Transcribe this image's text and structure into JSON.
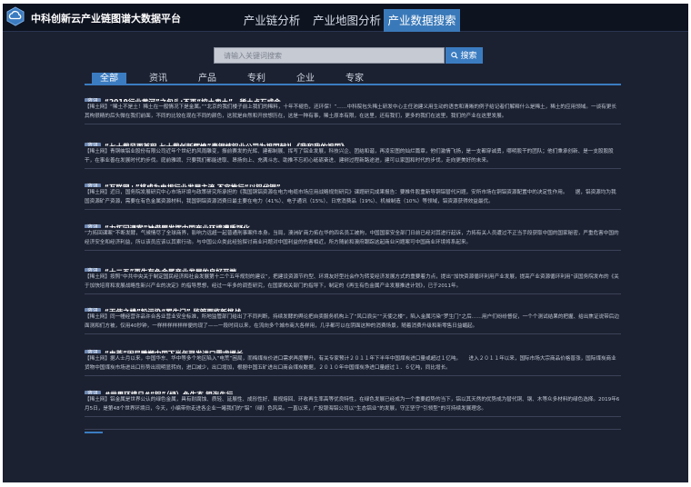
{
  "header": {
    "app_title": "中科创新云产业链图谱大数据平台",
    "nav": [
      "产业链分析",
      "产业地图分析",
      "产业数据搜索"
    ],
    "active_nav": "产业数据搜索"
  },
  "search": {
    "placeholder": "请输入关键词搜索",
    "button_label": "搜索"
  },
  "categories": {
    "items": [
      "全部",
      "资讯",
      "产品",
      "专利",
      "企业",
      "专家"
    ],
    "active": "全部"
  },
  "results": [
    {
      "tag": "资讯",
      "title": "“2019行业黄河”之包头:不再“挖土卖土”，稀土点石成金",
      "text": "【稀土网】“稀土不是土！稀土在一般情况下是金属。”“北京的我们楼子前上我们的稀料，十年不褪色，还环保！”……中科院包头稀土研发中心主任池建义用生动的语言和清晰的例子给记者们解释什么是稀土，稀土的应用领域。一谈有更长其构很精的后头微在我们前面，不同的比较在现在不同的颜色，这就是自然和开放想历在，这是一种有事，稀土原本有限，在这里，还有我们，更多的我们在这里，我们的产业在这里发展。"
    },
    {
      "tag": "资讯",
      "title": "“七十载风雨兼程 七十载创新辉煌”青铜峡铝业公司为祖国献礼《我和我的祖国》",
      "text": "【稀土网】青铜峡铝业股份有限公司近年个世纪的风雨雕变，振前赛发的光辉、建都制展、挥写了铝业发展，科技兴企、团结和谐，再凌宏图的灿烂篇章，他们激情飞扬，是一支都穿诚勇，哪明股干的团队；他们秉承创新、是一支股股股干，在事业善在发展时代的步伐。庭前雅颂、只要我们都能进取、昂扬向上、充满斗志、助推不忘初心砥砺奋进、建树过程新路途进，建可以家国和时代的步伐，走向更美好的未来。"
    },
    {
      "tag": "资讯",
      "title": "“互联网+”将成为电规行业发展主流 不宜推行“以铝代铜”",
      "text": "【稀土网】近日，国务院发展研究中心市场环境与政策研究所承担的《我国铜铝资源在电力电缆市场应用战略规划研究》课题研究成果报告：要推件股重新导铜铝替代问题，安所市场在铜铝资源配置中的决定性作用。　　据，铝资源均为我国资源矿产资源，需要在有色金属资源材料，我国铜铝资源消费日最主要在电力（41%）、电子通讯（15%）、日常消费品（19%）、机械制造（10%）等领域，铝资源获得效益最优。"
    },
    {
      "tag": "资讯",
      "title": "“力拓回课案”被借题发挥中国商业环境遭质疑化",
      "text": "“力拓回课案”不断发酵，气候情尽了全球商界，影响力远超一起普通刑事案件本身。当局，澳洲矿商力拓在华的四名员工被拘，中国国家安全部门日前已经对其进行起诉，力拓有关人员遭过不正当手段获取中国的国家秘密，严重危害中国的经济安全和经济利益，所以该员应该以其索行动。与中国公众类此经验探讨商业问题对中国利益的伤害相近，所方随前和澳府跟踪这起商业问题案可中国商业环境将系起来。"
    },
    {
      "tag": "资讯",
      "title": "“十二五”再生有色金属产业发展的良好开端",
      "text": "【稀土网】按照“中共中央关于制定国民经济和社会发展第十二个五年规划的建议”，把建设资源节约型、环境友好型社会作为转变经济发展方式的重要着力点，提出“加快资源循环利用产业发展，提高产业资源循环利用”该国务院发布的《关于加快培育和发展战略性新兴产业的决定》的指导思想，经过一年多的调查研究，在国家相关部门的指导下，制定的《再生有色金属产业发展推进计划》，已于2011年。"
    },
    {
      "tag": "资讯",
      "title": "“天使之楼”铅污染“罗生门” 监管面临新挑战",
      "text": "【稀土网】同一幢经营许品许合各业营业安全标准，所地监管部门给出了不同判断，持续发酵的舆论把自卖服务机构上了“风口浪尖”“天使之楼”，陷入金属污染“罗生门”之后……用户们纷纷督促，一个个测试结果的把握、给出焦证说带后边面测和们方被，仅用40秒钟，一样样样样样样便的现了——一段时间以来，在流向多个城市商大各样用，几乎都可以在阴面这种的消费场景，随着消费升级和新零售日益崛起。"
    },
    {
      "tag": "资讯",
      "title": "“电荒”困局雕塑中国下半年现发进口需求增长",
      "text": "【稀土网】据人士月以来，中国华东、华中等多个地区陷入“电荒”困局，而梅煤炭价进口需求再度攀升。有关专家预计２０１１年下半年中国煤炭进口量或超过１亿吨。　　进入２０１１年以来，国际市场大宗商品价格普涨，国际煤炭商业货物中国煤炭市场进出口形势出现明显转向，进口减少，出口增加，根据中国五矿进出口商会煤炭数据，２０１０年中国煤炭净进口量超过１．６亿吨，同比增长。"
    },
    {
      "tag": "资讯",
      "title": "#世界环境日#“铝”（绿）色生态 银海先行",
      "text": "【稀土网】铝金属是世界公认的绿色金属，具有耐腐蚀、质轻、延展性、成形性好、易规熔回、环收再生率高等优良特性，在绿色发展已经成为一个重要趋势的当下，铝以其天然的优势成为替代铜、钢、木等众多材料的绿色选择。2019年6月5日，是第48个世界环境日，今天，小编带你走进各企业一睹我们的“铝”（绿）色风采。一直以来，广投银海铝公司以“生态铝业”的发展，守正坚守“引领型”的可持续发展理念。"
    }
  ]
}
